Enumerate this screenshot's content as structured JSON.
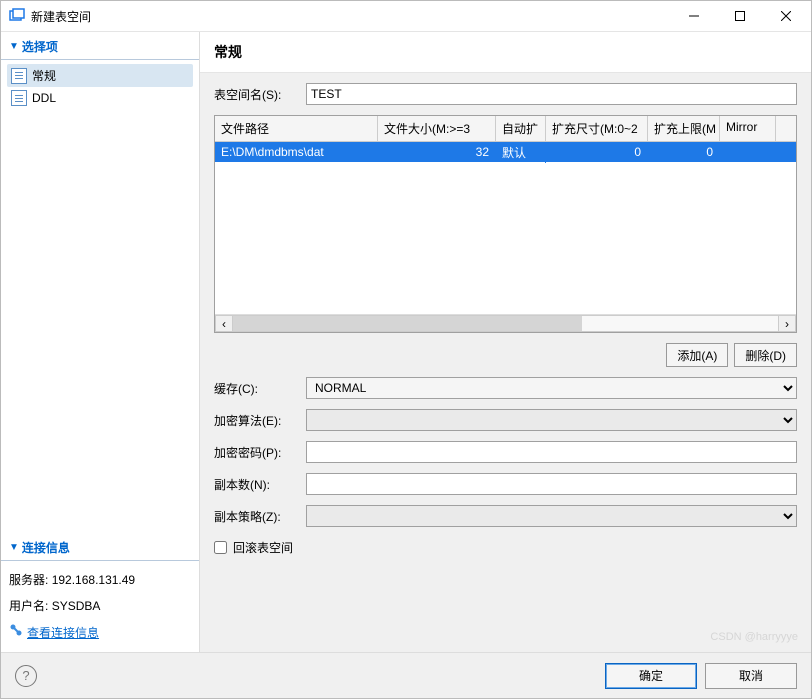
{
  "window": {
    "title": "新建表空间",
    "minimize": "–",
    "maximize": "□",
    "close": "✕"
  },
  "sidebar": {
    "options_header": "选择项",
    "items": [
      {
        "label": "常规",
        "selected": true
      },
      {
        "label": "DDL",
        "selected": false
      }
    ],
    "conn_header": "连接信息",
    "server_label": "服务器:",
    "server_value": "192.168.131.49",
    "user_label": "用户名:",
    "user_value": "SYSDBA",
    "view_conn": "查看连接信息"
  },
  "main": {
    "heading": "常规",
    "name_label": "表空间名(S):",
    "name_value": "TEST",
    "grid": {
      "headers": [
        "文件路径",
        "文件大小(M:>=3",
        "自动扩",
        "扩充尺寸(M:0~2",
        "扩充上限(M",
        "Mirror"
      ],
      "row": {
        "path": "E:\\DM\\dmdbms\\dat",
        "size": "32",
        "auto": "默认",
        "ext_size": "0",
        "ext_limit": "0",
        "mirror": ""
      }
    },
    "add_btn": "添加(A)",
    "del_btn": "删除(D)",
    "cache_label": "缓存(C):",
    "cache_value": "NORMAL",
    "enc_algo_label": "加密算法(E):",
    "enc_algo_value": "",
    "enc_pwd_label": "加密密码(P):",
    "enc_pwd_value": "",
    "replica_label": "副本数(N):",
    "replica_value": "",
    "policy_label": "副本策略(Z):",
    "policy_value": "",
    "rollback_label": "回滚表空间"
  },
  "footer": {
    "help": "?",
    "ok": "确定",
    "cancel": "取消"
  },
  "watermark": "CSDN @harryyye"
}
